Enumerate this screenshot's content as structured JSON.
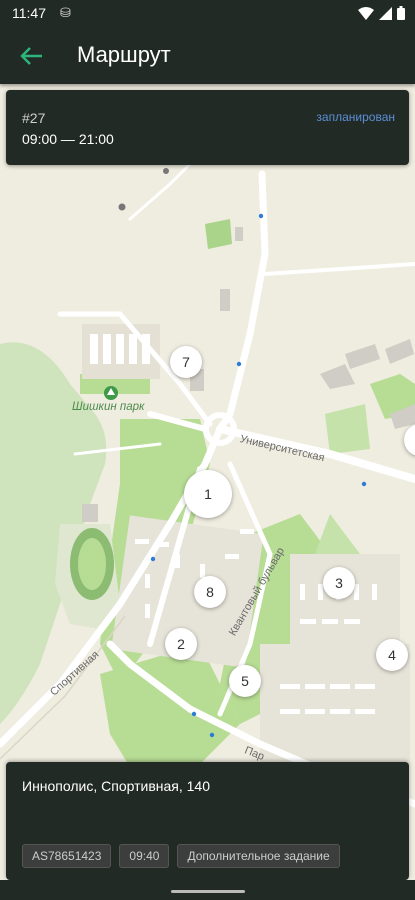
{
  "status_bar": {
    "time": "11:47"
  },
  "app_bar": {
    "title": "Маршрут"
  },
  "order_card": {
    "number": "#27",
    "hours": "09:00 — 21:00",
    "status": "запланирован"
  },
  "map": {
    "streets": {
      "universitetskaya": "Университетская",
      "kvantovy": "Квантовый бульвар",
      "sportivnaya": "Спортивная",
      "paradnaya": "Пар"
    },
    "park_name": "Шишкин парк",
    "markers": [
      "7",
      "1",
      "8",
      "2",
      "5",
      "3",
      "4"
    ]
  },
  "address_card": {
    "address": "Иннополис, Спортивная, 140",
    "chips": [
      "AS78651423",
      "09:40",
      "Дополнительное задание"
    ]
  },
  "colors": {
    "bar_bg": "#222a25",
    "accent_green": "#2db67b",
    "status_blue": "#5b8fd6",
    "map_land": "#efece0",
    "park_green": "#b7dc94"
  }
}
